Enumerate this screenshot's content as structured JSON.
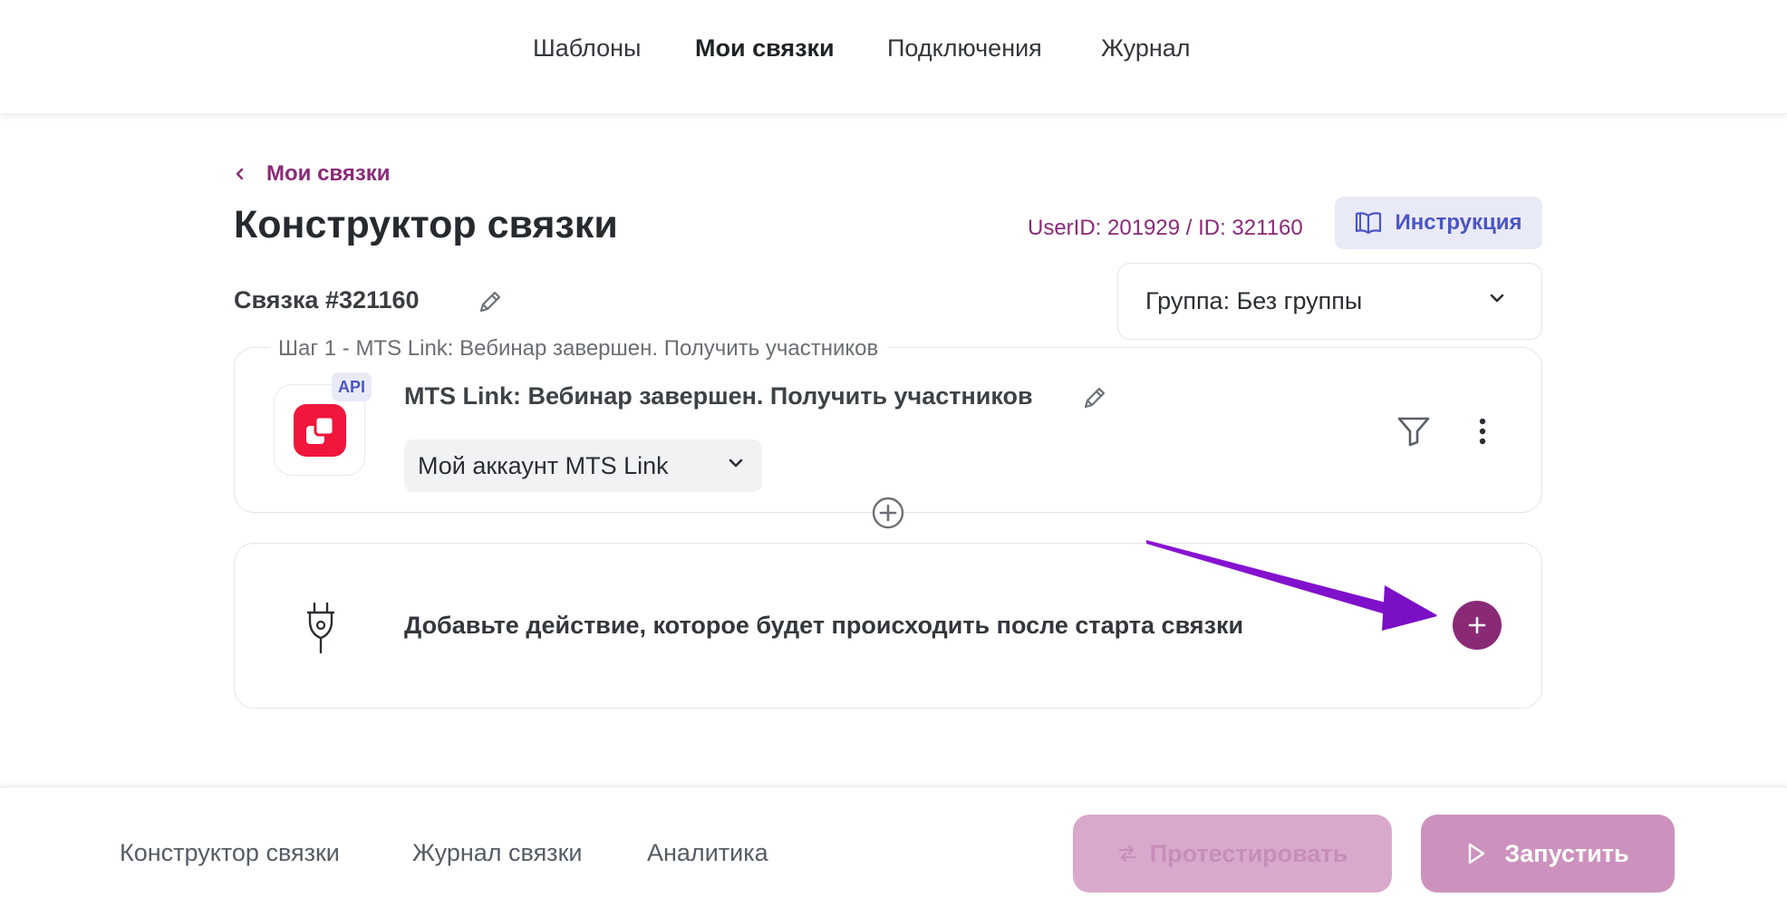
{
  "topnav": {
    "tabs": [
      {
        "label": "Шаблоны"
      },
      {
        "label": "Мои связки"
      },
      {
        "label": "Подключения"
      },
      {
        "label": "Журнал"
      }
    ],
    "active_tab": "Мои связки"
  },
  "header": {
    "back_label": "Мои связки",
    "title": "Конструктор связки",
    "ids": "UserID: 201929 / ID: 321160",
    "instruction_button": "Инструкция"
  },
  "bundle": {
    "name": "Связка #321160",
    "group_select": "Группа: Без группы"
  },
  "step": {
    "legend": "Шаг 1 - MTS Link: Вебинар завершен. Получить участников",
    "api_badge": "API",
    "title": "MTS Link: Вебинар завершен. Получить участников",
    "account_select": "Мой аккаунт MTS Link"
  },
  "action": {
    "text": "Добавьте действие, которое будет происходить после старта связки"
  },
  "bottombar": {
    "tabs": [
      {
        "label": "Конструктор связки"
      },
      {
        "label": "Журнал связки"
      },
      {
        "label": "Аналитика"
      }
    ],
    "test_button": "Протестировать",
    "run_button": "Запустить"
  },
  "colors": {
    "accent": "#8a2a77",
    "instruction_bg": "#e9eaf8",
    "instruction_text": "#4b55c4",
    "logo_red": "#f0163c",
    "annotation_arrow": "#8a14d4"
  }
}
